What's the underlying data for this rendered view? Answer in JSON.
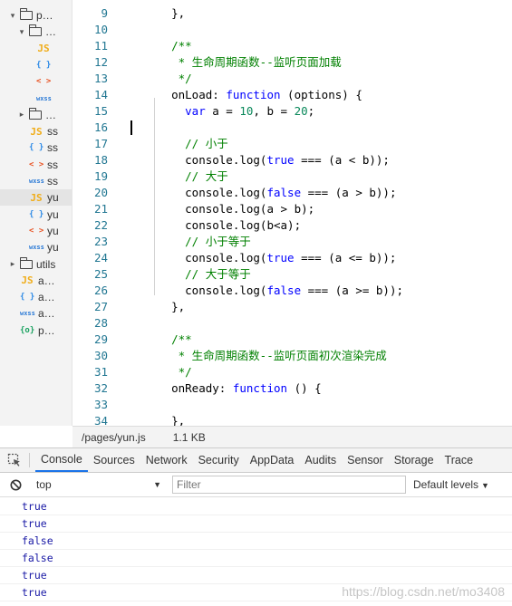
{
  "tree": [
    {
      "icon": "folder",
      "label": "p…",
      "twisty": "▾",
      "indent": 10
    },
    {
      "icon": "folder",
      "label": "…",
      "twisty": "▾",
      "indent": 20
    },
    {
      "icon": "js",
      "label": "",
      "twisty": "",
      "indent": 40
    },
    {
      "icon": "json",
      "label": "",
      "twisty": "",
      "indent": 40
    },
    {
      "icon": "wxml",
      "label": "",
      "twisty": "",
      "indent": 40
    },
    {
      "icon": "wxss",
      "label": "",
      "twisty": "",
      "indent": 40
    },
    {
      "icon": "folder",
      "label": "…",
      "twisty": "▸",
      "indent": 20
    },
    {
      "icon": "js",
      "label": "ss",
      "twisty": "",
      "indent": 32
    },
    {
      "icon": "json",
      "label": "ss",
      "twisty": "",
      "indent": 32
    },
    {
      "icon": "wxml",
      "label": "ss",
      "twisty": "",
      "indent": 32
    },
    {
      "icon": "wxss",
      "label": "ss",
      "twisty": "",
      "indent": 32
    },
    {
      "icon": "js",
      "label": "yu",
      "twisty": "",
      "indent": 32,
      "selected": true
    },
    {
      "icon": "json",
      "label": "yu",
      "twisty": "",
      "indent": 32
    },
    {
      "icon": "wxml",
      "label": "yu",
      "twisty": "",
      "indent": 32
    },
    {
      "icon": "wxss",
      "label": "yu",
      "twisty": "",
      "indent": 32
    },
    {
      "icon": "folder",
      "label": "utils",
      "twisty": "▸",
      "indent": 10
    },
    {
      "icon": "js",
      "label": "a…",
      "twisty": "",
      "indent": 22
    },
    {
      "icon": "json",
      "label": "a…",
      "twisty": "",
      "indent": 22
    },
    {
      "icon": "wxss",
      "label": "a…",
      "twisty": "",
      "indent": 22
    },
    {
      "icon": "cfg",
      "label": "p…",
      "twisty": "",
      "indent": 22
    }
  ],
  "icons": {
    "js": "JS",
    "json": "{ }",
    "wxml": "< >",
    "wxss": "wxss",
    "cfg": "{o}"
  },
  "code": [
    {
      "n": "9",
      "t": [
        [
          "p",
          "    },"
        ]
      ]
    },
    {
      "n": "10",
      "t": []
    },
    {
      "n": "11",
      "t": [
        [
          "c",
          "    /**"
        ]
      ]
    },
    {
      "n": "12",
      "t": [
        [
          "c",
          "     * 生命周期函数--监听页面加载"
        ]
      ]
    },
    {
      "n": "13",
      "t": [
        [
          "c",
          "     */"
        ]
      ]
    },
    {
      "n": "14",
      "t": [
        [
          "p",
          "    onLoad: "
        ],
        [
          "k",
          "function"
        ],
        [
          "p",
          " (options) {"
        ]
      ]
    },
    {
      "n": "15",
      "t": [
        [
          "p",
          "      "
        ],
        [
          "k",
          "var"
        ],
        [
          "p",
          " a = "
        ],
        [
          "n",
          "10"
        ],
        [
          "p",
          ", b = "
        ],
        [
          "n",
          "20"
        ],
        [
          "p",
          ";"
        ]
      ]
    },
    {
      "n": "16",
      "t": []
    },
    {
      "n": "17",
      "t": [
        [
          "c",
          "      // 小于"
        ]
      ]
    },
    {
      "n": "18",
      "t": [
        [
          "p",
          "      console.log("
        ],
        [
          "k",
          "true"
        ],
        [
          "p",
          " === (a < b));"
        ]
      ]
    },
    {
      "n": "19",
      "t": [
        [
          "c",
          "      // 大于"
        ]
      ]
    },
    {
      "n": "20",
      "t": [
        [
          "p",
          "      console.log("
        ],
        [
          "k",
          "false"
        ],
        [
          "p",
          " === (a > b));"
        ]
      ]
    },
    {
      "n": "21",
      "t": [
        [
          "p",
          "      console.log(a > b);"
        ]
      ]
    },
    {
      "n": "22",
      "t": [
        [
          "p",
          "      console.log(b<a);"
        ]
      ]
    },
    {
      "n": "23",
      "t": [
        [
          "c",
          "      // 小于等于"
        ]
      ]
    },
    {
      "n": "24",
      "t": [
        [
          "p",
          "      console.log("
        ],
        [
          "k",
          "true"
        ],
        [
          "p",
          " === (a <= b));"
        ]
      ]
    },
    {
      "n": "25",
      "t": [
        [
          "c",
          "      // 大于等于"
        ]
      ]
    },
    {
      "n": "26",
      "t": [
        [
          "p",
          "      console.log("
        ],
        [
          "k",
          "false"
        ],
        [
          "p",
          " === (a >= b));"
        ]
      ]
    },
    {
      "n": "27",
      "t": [
        [
          "p",
          "    },"
        ]
      ]
    },
    {
      "n": "28",
      "t": []
    },
    {
      "n": "29",
      "t": [
        [
          "c",
          "    /**"
        ]
      ]
    },
    {
      "n": "30",
      "t": [
        [
          "c",
          "     * 生命周期函数--监听页面初次渲染完成"
        ]
      ]
    },
    {
      "n": "31",
      "t": [
        [
          "c",
          "     */"
        ]
      ]
    },
    {
      "n": "32",
      "t": [
        [
          "p",
          "    onReady: "
        ],
        [
          "k",
          "function"
        ],
        [
          "p",
          " () {"
        ]
      ]
    },
    {
      "n": "33",
      "t": []
    },
    {
      "n": "34",
      "t": [
        [
          "p",
          "    },"
        ]
      ]
    }
  ],
  "status": {
    "path": "/pages/yun.js",
    "size": "1.1 KB"
  },
  "devtools": {
    "tabs": [
      "Console",
      "Sources",
      "Network",
      "Security",
      "AppData",
      "Audits",
      "Sensor",
      "Storage",
      "Trace"
    ],
    "active": "Console"
  },
  "console": {
    "context": "top",
    "filter_placeholder": "Filter",
    "levels": "Default levels",
    "logs": [
      "true",
      "true",
      "false",
      "false",
      "true",
      "true"
    ]
  },
  "watermark": "https://blog.csdn.net/mo3408",
  "colors": {
    "keyword": "#0000ff",
    "number": "#09885a",
    "comment": "#008000",
    "line_number": "#237893",
    "log_value": "#1a1aa6",
    "tab_underline": "#1a73e8"
  }
}
